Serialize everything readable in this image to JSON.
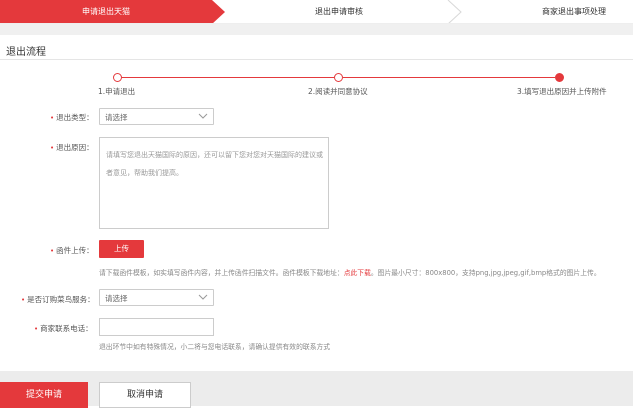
{
  "top_steps": [
    {
      "label": "申请退出天猫",
      "active": true
    },
    {
      "label": "退出申请审核",
      "active": false
    },
    {
      "label": "商家退出事项处理",
      "active": false
    }
  ],
  "section_title": "退出流程",
  "progress": [
    {
      "label": "1.申请退出",
      "done": false
    },
    {
      "label": "2.阅读并同意协议",
      "done": false
    },
    {
      "label": "3.填写退出原因并上传附件",
      "done": true
    }
  ],
  "form": {
    "type_label": "退出类型：",
    "type_value": "请选择",
    "reason_label": "退出原因：",
    "reason_placeholder": "请填写您退出天猫国际的原因，还可以留下您对您对天猫国际的建议或者意见，帮助我们提高。",
    "attach_label": "函件上传：",
    "upload_label": "上传",
    "upload_hint_pre": "请下载函件模板，如实填写函件内容，并上传函件扫描文件。函件模板下载地址：",
    "upload_hint_link": "点此下载",
    "upload_hint_post": "。图片最小尺寸：800x800，支持png,jpg,jpeg,gif,bmp格式的图片上传。",
    "cainiao_label": "是否订购菜鸟服务：",
    "cainiao_value": "请选择",
    "phone_label": "商家联系电话：",
    "phone_value": "",
    "phone_hint": "退出环节中如有特殊情况，小二将与您电话联系，请确认提供有效的联系方式"
  },
  "buttons": {
    "submit": "提交申请",
    "cancel": "取消申请"
  },
  "colors": {
    "accent": "#e4393c",
    "border": "#cccccc"
  }
}
